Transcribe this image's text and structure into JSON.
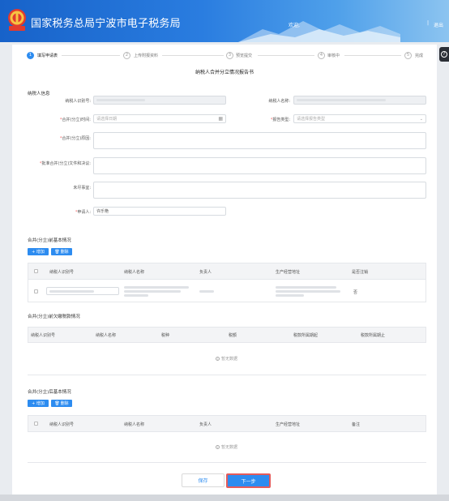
{
  "header": {
    "title": "国家税务总局宁波市电子税务局",
    "welcome": "欢迎,",
    "separator": "|",
    "logout": "退出",
    "help_icon": "question-icon"
  },
  "steps": [
    {
      "num": "1",
      "label": "填写申请表",
      "active": true
    },
    {
      "num": "2",
      "label": "上传附报资料",
      "active": false
    },
    {
      "num": "3",
      "label": "预览提交",
      "active": false
    },
    {
      "num": "4",
      "label": "审核中",
      "active": false
    },
    {
      "num": "5",
      "label": "完成",
      "active": false
    }
  ],
  "form": {
    "title": "纳税人合并分立情况报告书",
    "section_info": "纳税人信息",
    "taxpayer_id_label": "纳税人识别号:",
    "taxpayer_name_label": "纳税人名称:",
    "merge_time_label": "合并(分立)时间:",
    "merge_time_placeholder": "请选择日期",
    "report_type_label": "报告类型:",
    "report_type_placeholder": "请选择报告类型",
    "merge_reason_label": "合并(分立)原因:",
    "approval_doc_label": "批准合并(分立)文件和决议:",
    "pending_matters_label": "未尽事宜:",
    "applicant_label": "申请人:",
    "applicant_value": "许乐艳",
    "required_mark": "*"
  },
  "before_section": {
    "title": "合并(分立)前基本情况",
    "add_label": "+ 增加",
    "delete_label": "删除",
    "columns": [
      "纳税人识别号",
      "纳税人名称",
      "负责人",
      "生产经营地址",
      "是否注销"
    ],
    "rows": [
      {
        "cancelled": "否"
      }
    ]
  },
  "tax_section": {
    "title": "合并(分立)前欠缴税款情况",
    "columns": [
      "纳税人识别号",
      "纳税人名称",
      "税种",
      "税额",
      "税款所属期起",
      "税款所属期止"
    ],
    "empty_text": "暂无数据"
  },
  "after_section": {
    "title": "合并(分立)后基本情况",
    "add_label": "+ 增加",
    "delete_label": "删除",
    "columns": [
      "纳税人识别号",
      "纳税人名称",
      "负责人",
      "生产经营地址",
      "备注"
    ],
    "empty_text": "暂无数据"
  },
  "footer": {
    "save_label": "保存",
    "next_label": "下一步"
  }
}
